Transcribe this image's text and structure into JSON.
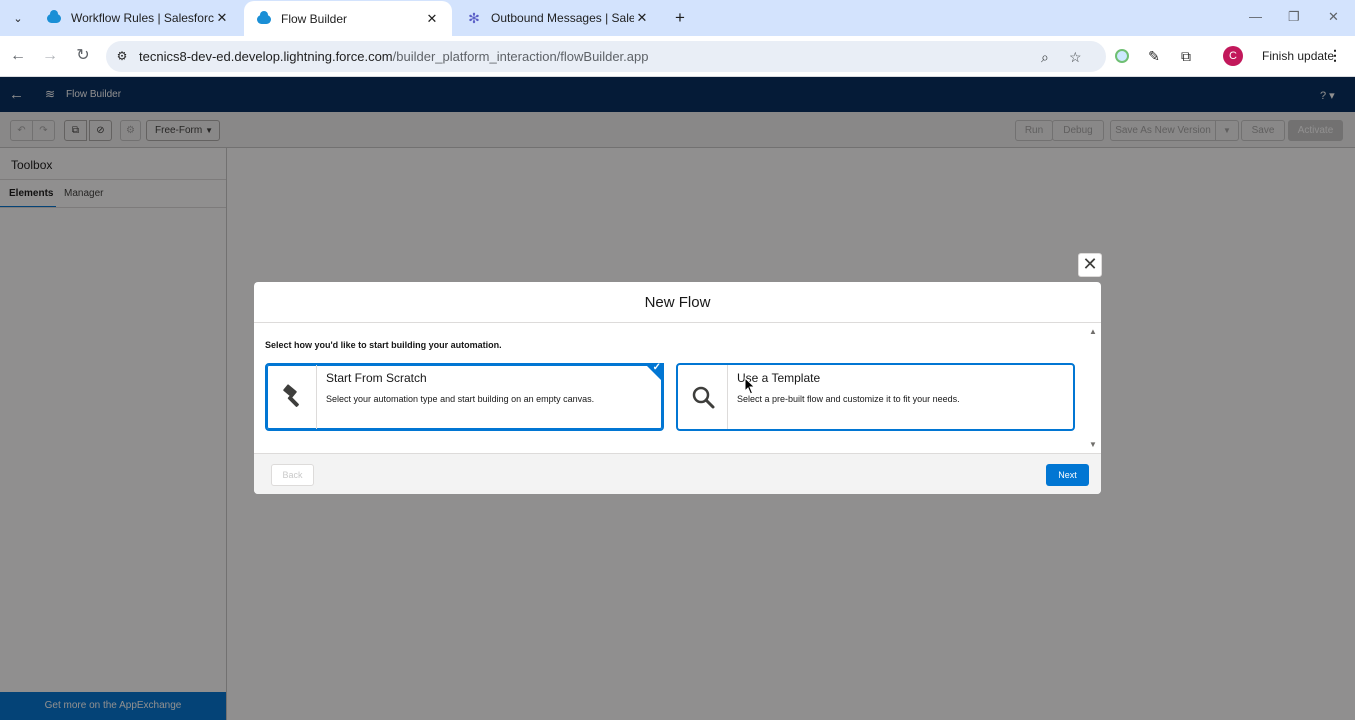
{
  "browser": {
    "tabs": [
      {
        "title": "Workflow Rules | Salesforce",
        "icon": "salesforce-cloud-icon"
      },
      {
        "title": "Flow Builder",
        "icon": "salesforce-cloud-icon"
      },
      {
        "title": "Outbound Messages | Salesforc",
        "icon": "gear-flower-icon"
      }
    ],
    "url_host": "tecnics8-dev-ed.develop.lightning.force.com",
    "url_path": "/builder_platform_interaction/flowBuilder.app",
    "profile_initial": "C",
    "finish_update_label": "Finish update"
  },
  "sf_header": {
    "title": "Flow Builder",
    "help": "? ▾"
  },
  "toolbar": {
    "layout_select": "Free-Form",
    "run": "Run",
    "debug": "Debug",
    "save_as_new_version": "Save As New Version",
    "save": "Save",
    "activate": "Activate"
  },
  "toolbox": {
    "title": "Toolbox",
    "tab_elements": "Elements",
    "tab_manager": "Manager",
    "appexchange_link": "Get more on the AppExchange"
  },
  "modal": {
    "title": "New Flow",
    "prompt": "Select how you'd like to start building your automation.",
    "options": [
      {
        "title": "Start From Scratch",
        "description": "Select your automation type and start building on an empty canvas.",
        "icon": "hammer-icon",
        "selected": true
      },
      {
        "title": "Use a Template",
        "description": "Select a pre-built flow and customize it to fit your needs.",
        "icon": "search-icon",
        "selected": false
      }
    ],
    "back_label": "Back",
    "next_label": "Next"
  },
  "colors": {
    "brand_blue": "#0176d3",
    "header_navy": "#032d60",
    "chrome_tabbar": "#d3e3fd"
  }
}
